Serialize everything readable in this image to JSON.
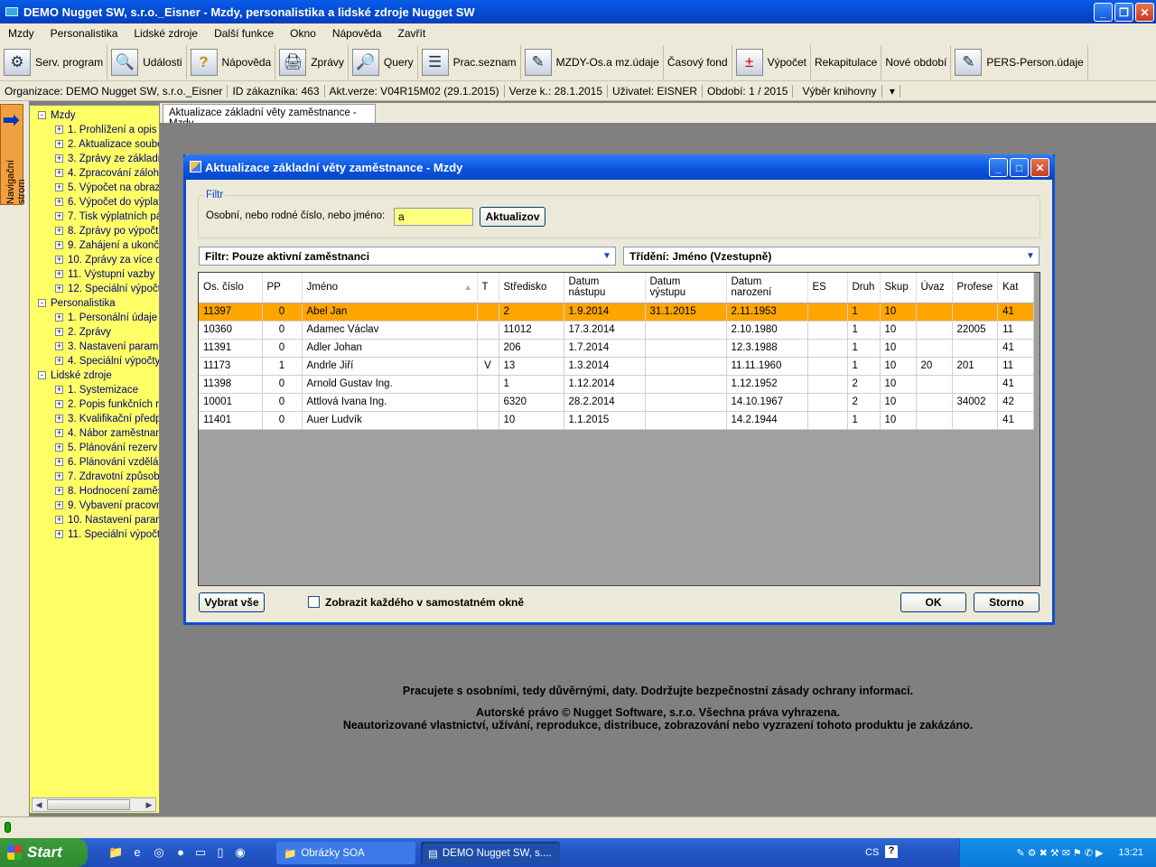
{
  "window": {
    "title": "DEMO Nugget SW, s.r.o._Eisner - Mzdy, personalistika a lidské zdroje Nugget SW"
  },
  "menu": [
    "Mzdy",
    "Personalistika",
    "Lidské zdroje",
    "Další funkce",
    "Okno",
    "Nápověda",
    "Zavřít"
  ],
  "toolbar": [
    {
      "label": "Serv. program",
      "icon": "gear-icon"
    },
    {
      "label": "Události",
      "icon": "magnifier-icon"
    },
    {
      "label": "Nápověda",
      "icon": "question-icon"
    },
    {
      "label": "Zprávy",
      "icon": "printer-icon"
    },
    {
      "label": "Query",
      "icon": "query-icon"
    },
    {
      "label": "Prac.seznam",
      "icon": "list-icon"
    },
    {
      "label": "MZDY-Os.a mz.údaje",
      "icon": "pen-icon"
    },
    {
      "label": "Časový fond",
      "icon": ""
    },
    {
      "label": "Výpočet",
      "icon": "calculator-icon"
    },
    {
      "label": "Rekapitulace",
      "icon": ""
    },
    {
      "label": "Nové období",
      "icon": ""
    },
    {
      "label": "PERS-Person.údaje",
      "icon": "pen-icon"
    }
  ],
  "infobar": {
    "org": "Organizace: DEMO Nugget SW, s.r.o._Eisner",
    "customer": "ID zákazníka: 463",
    "version": "Akt.verze: V04R15M02 (29.1.2015)",
    "version_k": "Verze k.: 28.1.2015",
    "user": "Uživatel: EISNER",
    "period": "Období: 1 / 2015",
    "library": "Výběr knihovny"
  },
  "nav": {
    "label": "Navigační strom",
    "tree": [
      {
        "label": "Mzdy",
        "level": 0,
        "toggle": "-"
      },
      {
        "label": "1. Prohlížení a opis s",
        "level": 1,
        "toggle": "+"
      },
      {
        "label": "2. Aktualizace soubo",
        "level": 1,
        "toggle": "+"
      },
      {
        "label": "3. Zprávy ze základn",
        "level": 1,
        "toggle": "+"
      },
      {
        "label": "4. Zpracování záloh",
        "level": 1,
        "toggle": "+"
      },
      {
        "label": "5. Výpočet na obraz",
        "level": 1,
        "toggle": "+"
      },
      {
        "label": "6. Výpočet do výplat",
        "level": 1,
        "toggle": "+"
      },
      {
        "label": "7. Tisk výplatních pá",
        "level": 1,
        "toggle": "+"
      },
      {
        "label": "8. Zprávy po výpočtu",
        "level": 1,
        "toggle": "+"
      },
      {
        "label": "9. Zahájení a ukonče",
        "level": 1,
        "toggle": "+"
      },
      {
        "label": "10. Zprávy za více o",
        "level": 1,
        "toggle": "+"
      },
      {
        "label": "11. Výstupní vazby",
        "level": 1,
        "toggle": "+"
      },
      {
        "label": "12. Speciální výpočty",
        "level": 1,
        "toggle": "+"
      },
      {
        "label": "Personalistika",
        "level": 0,
        "toggle": "-"
      },
      {
        "label": "1. Personální údaje",
        "level": 1,
        "toggle": "+"
      },
      {
        "label": "2. Zprávy",
        "level": 1,
        "toggle": "+"
      },
      {
        "label": "3. Nastavení parame",
        "level": 1,
        "toggle": "+"
      },
      {
        "label": "4. Speciální výpočty",
        "level": 1,
        "toggle": "+"
      },
      {
        "label": "Lidské zdroje",
        "level": 0,
        "toggle": "-"
      },
      {
        "label": "1. Systemizace",
        "level": 1,
        "toggle": "+"
      },
      {
        "label": "2. Popis funkčních m",
        "level": 1,
        "toggle": "+"
      },
      {
        "label": "3. Kvalifikační předp",
        "level": 1,
        "toggle": "+"
      },
      {
        "label": "4. Nábor zaměstnan",
        "level": 1,
        "toggle": "+"
      },
      {
        "label": "5. Plánování rezerv",
        "level": 1,
        "toggle": "+"
      },
      {
        "label": "6. Plánování vzdělá",
        "level": 1,
        "toggle": "+"
      },
      {
        "label": "7. Zdravotní způsob",
        "level": 1,
        "toggle": "+"
      },
      {
        "label": "8. Hodnocení zaměs",
        "level": 1,
        "toggle": "+"
      },
      {
        "label": "9. Vybavení pracovn",
        "level": 1,
        "toggle": "+"
      },
      {
        "label": "10. Nastavení param",
        "level": 1,
        "toggle": "+"
      },
      {
        "label": "11. Speciální výpočty",
        "level": 1,
        "toggle": "+"
      }
    ]
  },
  "doc_tab": "Aktualizace základní věty zaměstnance - Mzdy",
  "dialog": {
    "title": "Aktualizace základní věty zaměstnance - Mzdy",
    "filter_group": "Filtr",
    "filter_label": "Osobní, nebo rodné číslo, nebo jméno:",
    "filter_value": "a",
    "refresh_button": "Aktualizov",
    "filter_combo": "Filtr: Pouze aktivní zaměstnanci",
    "sort_combo": "Třídění: Jméno (Vzestupně)",
    "columns": [
      "Os. číslo",
      "PP",
      "Jméno",
      "T",
      "Středisko",
      "Datum nástupu",
      "Datum výstupu",
      "Datum narození",
      "ES",
      "Druh",
      "Skup",
      "Úvaz",
      "Profese",
      "Kat"
    ],
    "rows": [
      [
        "11397",
        "0",
        "Abel Jan",
        "",
        "2",
        "1.9.2014",
        "31.1.2015",
        "2.11.1953",
        "",
        "1",
        "10",
        "",
        "",
        "41"
      ],
      [
        "10360",
        "0",
        "Adamec Václav",
        "",
        "11012",
        "17.3.2014",
        "",
        "2.10.1980",
        "",
        "1",
        "10",
        "",
        "22005",
        "11"
      ],
      [
        "11391",
        "0",
        "Adler Johan",
        "",
        "206",
        "1.7.2014",
        "",
        "12.3.1988",
        "",
        "1",
        "10",
        "",
        "",
        "41"
      ],
      [
        "11173",
        "1",
        "Andrle Jiří",
        "V",
        "13",
        "1.3.2014",
        "",
        "11.11.1960",
        "",
        "1",
        "10",
        "20",
        "201",
        "11"
      ],
      [
        "11398",
        "0",
        "Arnold Gustav Ing.",
        "",
        "1",
        "1.12.2014",
        "",
        "1.12.1952",
        "",
        "2",
        "10",
        "",
        "",
        "41"
      ],
      [
        "10001",
        "0",
        "Attlová Ivana Ing.",
        "",
        "6320",
        "28.2.2014",
        "",
        "14.10.1967",
        "",
        "2",
        "10",
        "",
        "34002",
        "42"
      ],
      [
        "11401",
        "0",
        "Auer Ludvík",
        "",
        "10",
        "1.1.2015",
        "",
        "14.2.1944",
        "",
        "1",
        "10",
        "",
        "",
        "41"
      ]
    ],
    "select_all_button": "Vybrat vše",
    "checkbox_label": "Zobrazit každého v samostatném okně",
    "ok_button": "OK",
    "cancel_button": "Storno"
  },
  "notice": {
    "line1": "Pracujete s osobními, tedy důvěrnými, daty. Dodržujte bezpečnostní zásady ochrany informací.",
    "line2": "Autorské právo © Nugget Software, s.r.o. Všechna práva vyhrazena.",
    "line3": "Neautorizované vlastnictví, užívání, reprodukce, distribuce, zobrazování nebo vyzrazení tohoto produktu je zakázáno."
  },
  "taskbar": {
    "start": "Start",
    "tasks": [
      "Obrázky SOA",
      "DEMO Nugget SW, s...."
    ],
    "lang": "CS",
    "clock": "13:21"
  },
  "colors": {
    "selection": "#ffa500",
    "tree_bg": "#ffff66",
    "title_blue": "#0a54e0"
  }
}
